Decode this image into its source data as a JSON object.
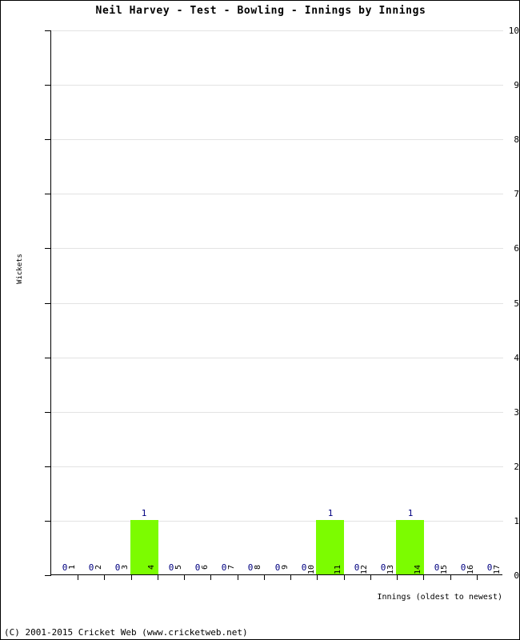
{
  "chart_data": {
    "type": "bar",
    "title": "Neil Harvey - Test - Bowling - Innings by Innings",
    "xlabel": "Innings (oldest to newest)",
    "ylabel": "Wickets",
    "categories": [
      "1",
      "2",
      "3",
      "4",
      "5",
      "6",
      "7",
      "8",
      "9",
      "10",
      "11",
      "12",
      "13",
      "14",
      "15",
      "16",
      "17"
    ],
    "values": [
      0,
      0,
      0,
      1,
      0,
      0,
      0,
      0,
      0,
      0,
      1,
      0,
      0,
      1,
      0,
      0,
      0
    ],
    "data_labels": [
      "0",
      "0",
      "0",
      "1",
      "0",
      "0",
      "0",
      "0",
      "0",
      "0",
      "1",
      "0",
      "0",
      "1",
      "0",
      "0",
      "0"
    ],
    "ylim": [
      0,
      10
    ],
    "y_ticks": [
      "0",
      "1",
      "2",
      "3",
      "4",
      "5",
      "6",
      "7",
      "8",
      "9",
      "10"
    ],
    "grid": true,
    "legend": "none",
    "bar_color": "#7cfc00",
    "data_label_color": "#000080",
    "gridline_color": "#e3e3e3",
    "axis_color": "#000000",
    "background_color": "#ffffff"
  },
  "footer": {
    "copyright": "(C) 2001-2015 Cricket Web (www.cricketweb.net)"
  }
}
